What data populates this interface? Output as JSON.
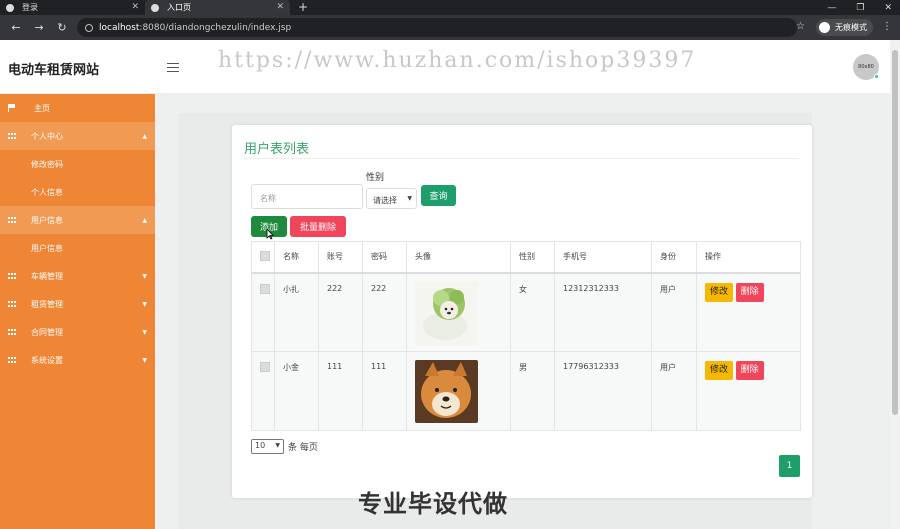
{
  "browser": {
    "tabs": [
      {
        "label": "登录",
        "active": false
      },
      {
        "label": "入口页",
        "active": true
      }
    ],
    "url_host": "localhost",
    "url_rest": ":8080/diandongchezulin/index.jsp",
    "incognito_label": "无痕模式"
  },
  "header": {
    "site_title": "电动车租赁网站",
    "avatar_text": "80x80"
  },
  "watermark": "https://www.huzhan.com/ishop39397",
  "sidebar": {
    "items": [
      {
        "label": "主页",
        "type": "flag"
      },
      {
        "label": "个人中心",
        "type": "parent",
        "open": true
      },
      {
        "label": "修改密码",
        "type": "sub"
      },
      {
        "label": "个人信息",
        "type": "sub"
      },
      {
        "label": "用户信息",
        "type": "parent",
        "open": true
      },
      {
        "label": "用户信息",
        "type": "sub"
      },
      {
        "label": "车辆管理",
        "type": "parent"
      },
      {
        "label": "租赁管理",
        "type": "parent"
      },
      {
        "label": "合同管理",
        "type": "parent"
      },
      {
        "label": "系统设置",
        "type": "parent"
      }
    ]
  },
  "main": {
    "card_title": "用户表列表",
    "search": {
      "name_placeholder": "名称",
      "sex_label": "性别",
      "sex_value": "请选择",
      "query_label": "查询"
    },
    "add_label": "添加",
    "batch_delete_label": "批量删除",
    "table": {
      "headers": [
        "",
        "名称",
        "账号",
        "密码",
        "头像",
        "性别",
        "手机号",
        "身份",
        "操作"
      ],
      "rows": [
        {
          "name": "小扎",
          "account": "222",
          "password": "222",
          "avatar": "cabbage-dog-image",
          "sex": "女",
          "phone": "12312312333",
          "role": "用户"
        },
        {
          "name": "小金",
          "account": "111",
          "password": "111",
          "avatar": "shiba-dog-image",
          "sex": "男",
          "phone": "17796312333",
          "role": "用户"
        }
      ],
      "edit_label": "修改",
      "delete_label": "删除"
    },
    "pagination": {
      "page_size": "10",
      "per_page_text": "条 每页",
      "current_page": "1"
    }
  },
  "caption": "专业毕设代做",
  "colors": {
    "sidebar": "#ee8636",
    "accent_green": "#1e9e6b",
    "danger": "#f0455a",
    "warning": "#f6b800"
  }
}
